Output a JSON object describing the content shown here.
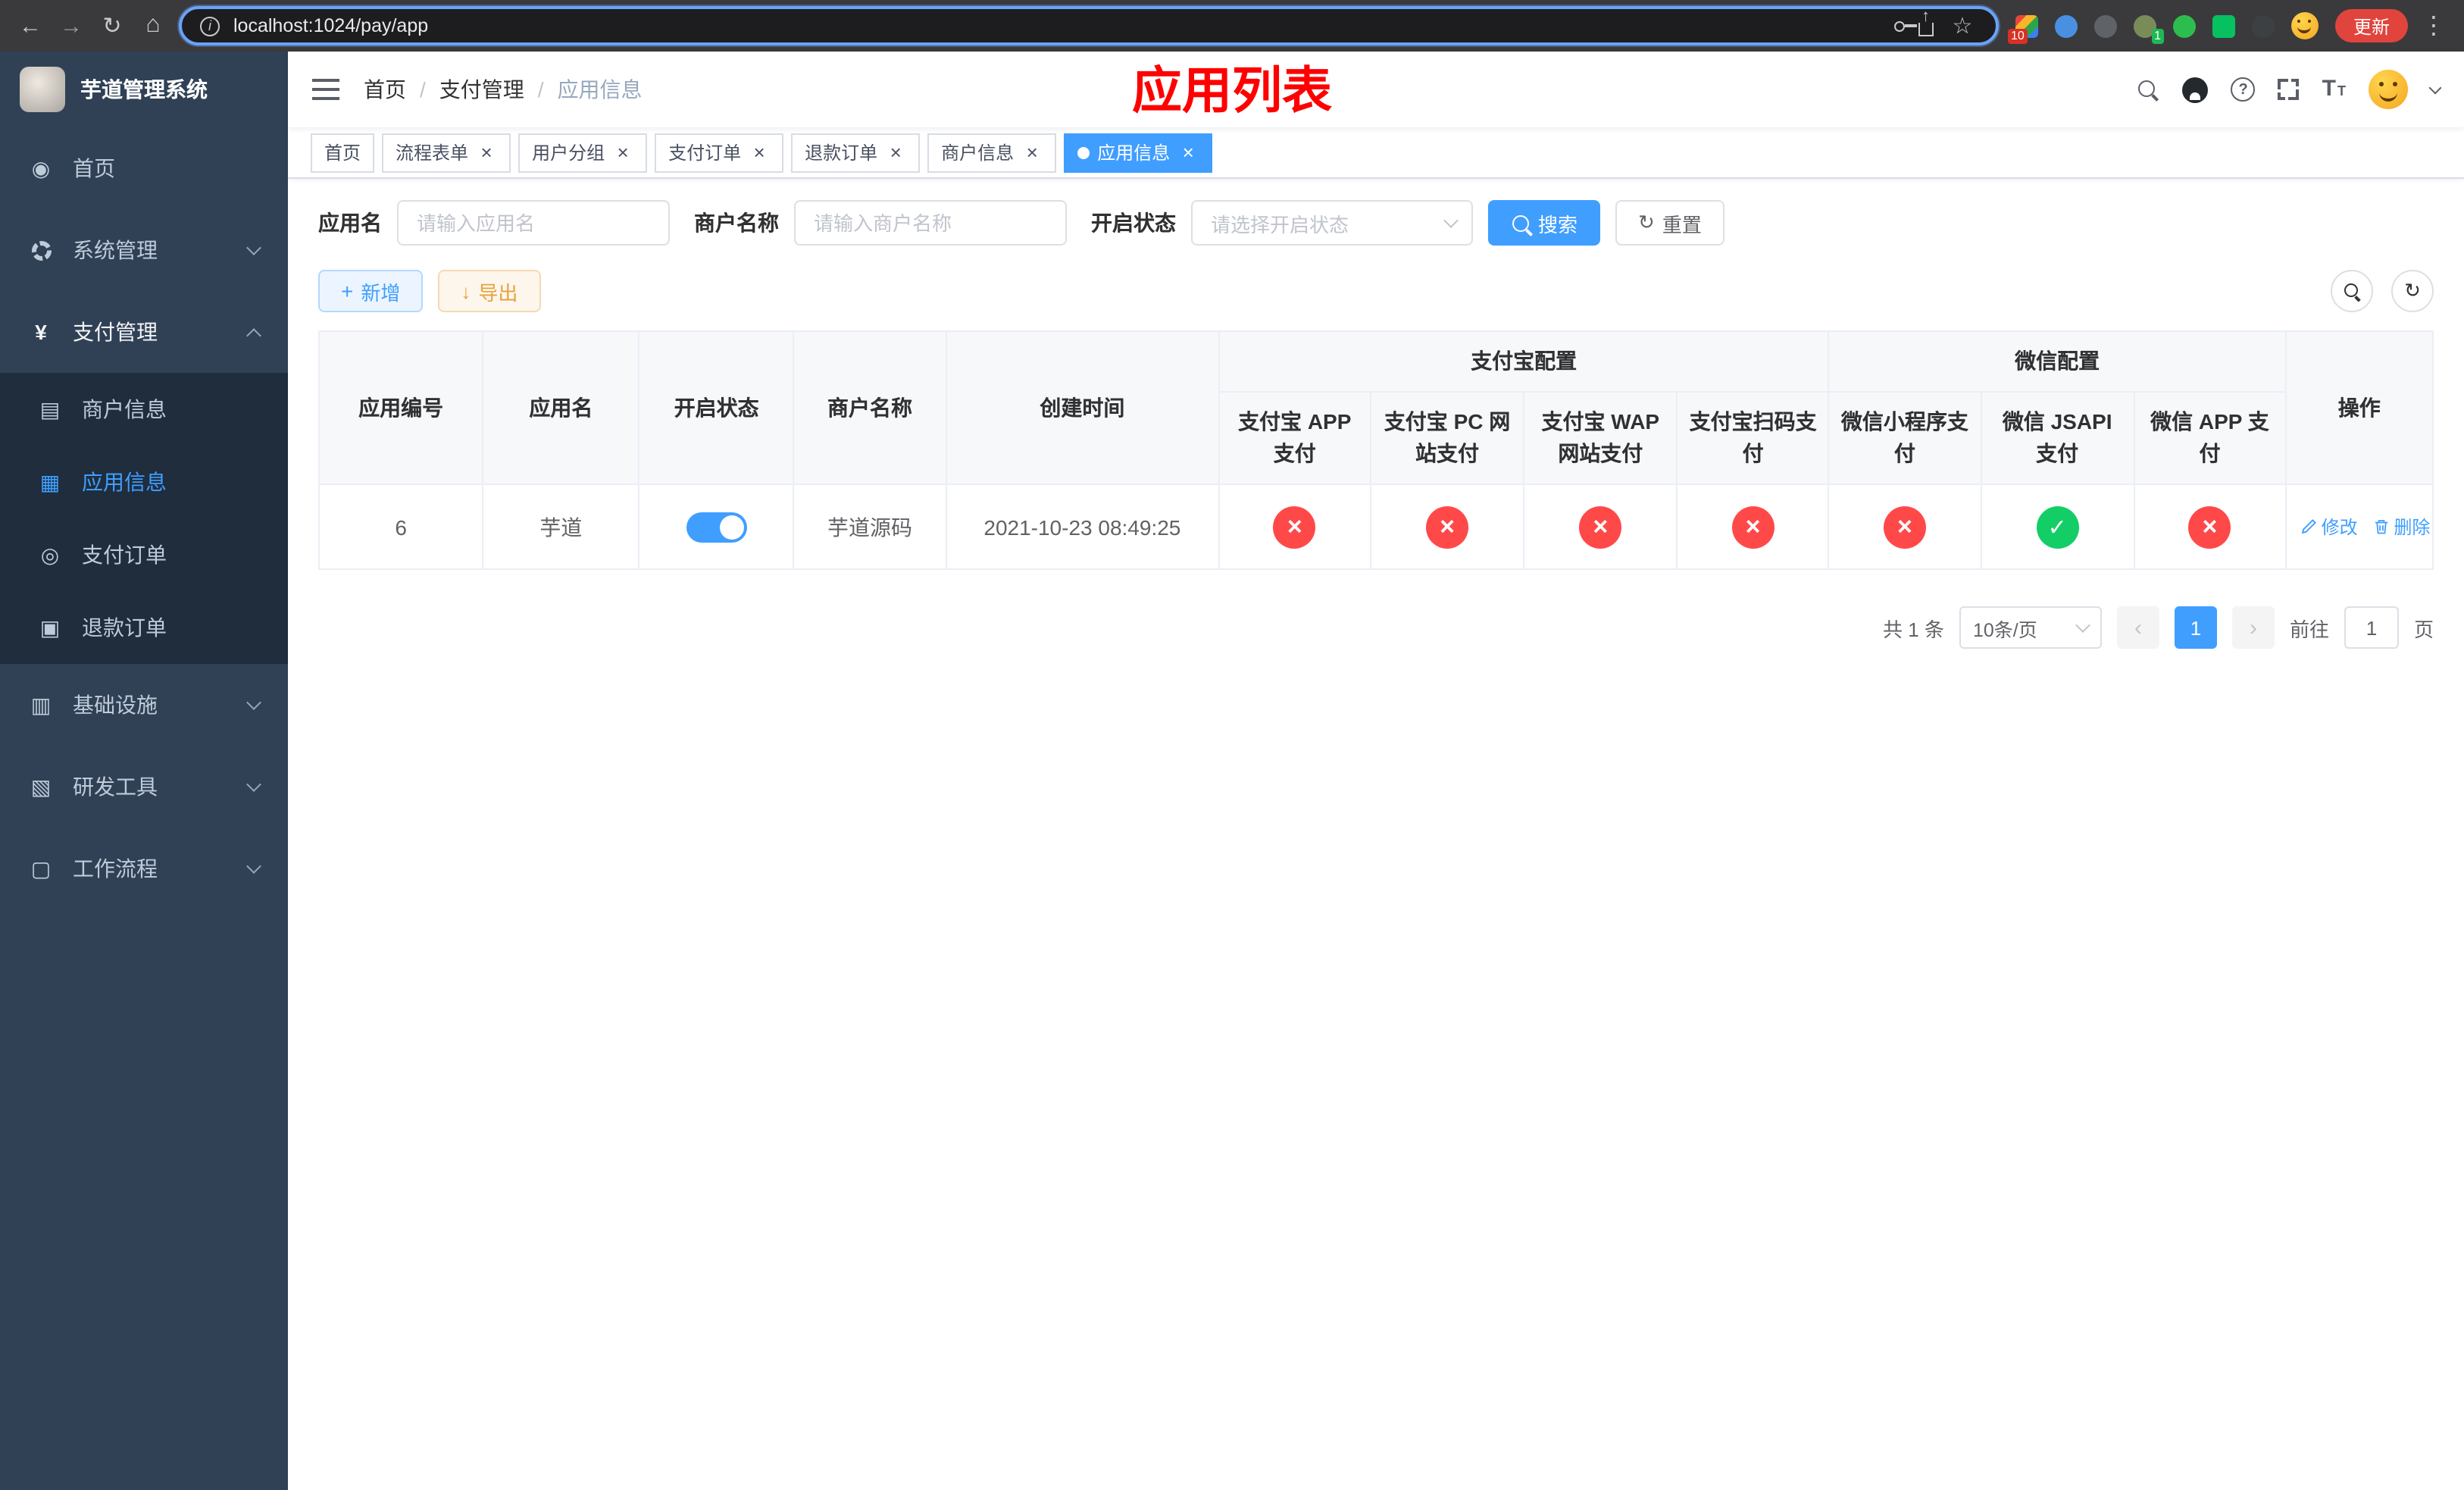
{
  "browser": {
    "url": "localhost:1024/pay/app",
    "update_button": "更新",
    "extension_badge_count": "10",
    "profile_badge_count": "1"
  },
  "sidebar": {
    "app_title": "芋道管理系统",
    "items": [
      "首页",
      "系统管理",
      "支付管理",
      "基础设施",
      "研发工具",
      "工作流程"
    ],
    "payment_submenu": [
      "商户信息",
      "应用信息",
      "支付订单",
      "退款订单"
    ]
  },
  "header": {
    "breadcrumb": [
      "首页",
      "支付管理",
      "应用信息"
    ],
    "page_title": "应用列表"
  },
  "tabs": [
    "首页",
    "流程表单",
    "用户分组",
    "支付订单",
    "退款订单",
    "商户信息",
    "应用信息"
  ],
  "filters": {
    "app_name_label": "应用名",
    "app_name_placeholder": "请输入应用名",
    "merchant_name_label": "商户名称",
    "merchant_name_placeholder": "请输入商户名称",
    "status_label": "开启状态",
    "status_placeholder": "请选择开启状态",
    "search_button": "搜索",
    "reset_button": "重置"
  },
  "toolbar": {
    "add_button": "新增",
    "export_button": "导出"
  },
  "table": {
    "group_headers": {
      "alipay": "支付宝配置",
      "wechat": "微信配置"
    },
    "columns": {
      "app_id": "应用编号",
      "app_name": "应用名",
      "status": "开启状态",
      "merchant_name": "商户名称",
      "create_time": "创建时间",
      "alipay_app": "支付宝 APP 支付",
      "alipay_pc": "支付宝 PC 网站支付",
      "alipay_wap": "支付宝 WAP 网站支付",
      "alipay_qr": "支付宝扫码支付",
      "wechat_lite": "微信小程序支付",
      "wechat_jsapi": "微信 JSAPI 支付",
      "wechat_app": "微信 APP 支付",
      "actions": "操作"
    },
    "row": {
      "app_id": "6",
      "app_name": "芋道",
      "status_enabled": true,
      "merchant_name": "芋道源码",
      "create_time": "2021-10-23 08:49:25",
      "flags": {
        "alipay_app": false,
        "alipay_pc": false,
        "alipay_wap": false,
        "alipay_qr": false,
        "wechat_lite": false,
        "wechat_jsapi": true,
        "wechat_app": false
      },
      "edit_label": "修改",
      "delete_label": "删除"
    }
  },
  "pagination": {
    "total_text": "共 1 条",
    "page_size_text": "10条/页",
    "current_page": "1",
    "goto_prefix": "前往",
    "goto_value": "1",
    "goto_suffix": "页"
  },
  "colors": {
    "primary": "#409EFF",
    "success": "#13ce66",
    "danger": "#ff4949",
    "title_red": "#ff0000",
    "sidebar_bg": "#304156",
    "submenu_bg": "#1f2d3d"
  }
}
